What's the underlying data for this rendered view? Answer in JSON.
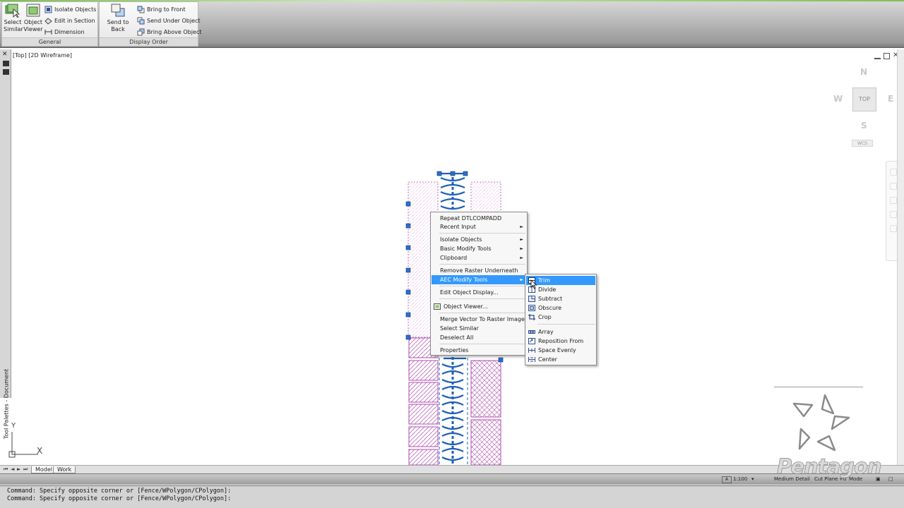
{
  "ribbon": {
    "general": {
      "title": "General",
      "select_similar": "Select Similar",
      "object_viewer": "Object Viewer",
      "isolate_objects": "Isolate Objects",
      "edit_in_section": "Edit in Section",
      "dimension": "Dimension"
    },
    "display_order": {
      "title": "Display Order",
      "send_to_back": "Send to Back",
      "bring_to_front": "Bring to Front",
      "send_under_object": "Send Under Object",
      "bring_above_object": "Bring Above Object"
    }
  },
  "palette": {
    "vertical_label": "Tool Palettes - Document"
  },
  "viewport": {
    "label": "[Top] [2D Wireframe]",
    "viewcube": {
      "north": "N",
      "south": "S",
      "east": "E",
      "west": "W",
      "face": "TOP",
      "wcs": "WCS"
    },
    "ucs": {
      "x": "X",
      "y": "Y"
    }
  },
  "context_menu": {
    "items": [
      "Repeat DTLCOMPADD",
      "Recent Input",
      "Isolate Objects",
      "Basic Modify Tools",
      "Clipboard",
      "Remove Raster Underneath",
      "AEC Modify Tools",
      "Edit Object Display...",
      "Object Viewer...",
      "Merge Vector To Raster Image",
      "Select Similar",
      "Deselect All",
      "Properties"
    ],
    "highlighted": "AEC Modify Tools"
  },
  "submenu": {
    "items": [
      "Trim",
      "Divide",
      "Subtract",
      "Obscure",
      "Crop",
      "Array",
      "Reposition From",
      "Space Evenly",
      "Center"
    ],
    "highlighted": "Trim"
  },
  "layout_tabs": {
    "model": "Model",
    "work": "Work"
  },
  "statusbar": {
    "scale": "1:100",
    "detail": "Medium Detail",
    "cut_plane": "Cut Plane",
    "elevation": "+0",
    "mode": "Mode"
  },
  "command_line": {
    "line1": "Command: Specify opposite corner or [Fence/WPolygon/CPolygon]:",
    "line2": "Command: Specify opposite corner or [Fence/WPolygon/CPolygon]:"
  },
  "watermark": {
    "text": "Pentagon"
  },
  "colors": {
    "ribbon_accent": "#7fbf57",
    "menu_highlight": "#3399ff",
    "grip": "#2d6fc9",
    "hatch": "#b04cb0"
  }
}
